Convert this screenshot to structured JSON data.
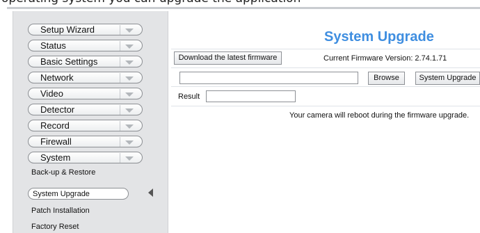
{
  "caption": "operating system you can upgrade the application",
  "sidebar": {
    "items": [
      {
        "label": "Setup Wizard"
      },
      {
        "label": "Status"
      },
      {
        "label": "Basic Settings"
      },
      {
        "label": "Network"
      },
      {
        "label": "Video"
      },
      {
        "label": "Detector"
      },
      {
        "label": "Record"
      },
      {
        "label": "Firewall"
      },
      {
        "label": "System"
      }
    ],
    "system_submenu": [
      {
        "label": "Back-up & Restore"
      },
      {
        "label": "System Upgrade",
        "active": true
      },
      {
        "label": "Patch Installation"
      },
      {
        "label": "Factory Reset"
      }
    ]
  },
  "main": {
    "title": "System Upgrade",
    "download_button": "Download the latest firmware",
    "firmware_version_text": "Current Firmware Version: 2.74.1.71",
    "file_path_value": "",
    "browse_button": "Browse",
    "upgrade_button": "System Upgrade",
    "result_label": "Result",
    "result_value": "",
    "notice": "Your camera will reboot during the firmware upgrade."
  },
  "colors": {
    "title": "#3f8ee0",
    "sidebar_bg": "#e3e4e6"
  }
}
